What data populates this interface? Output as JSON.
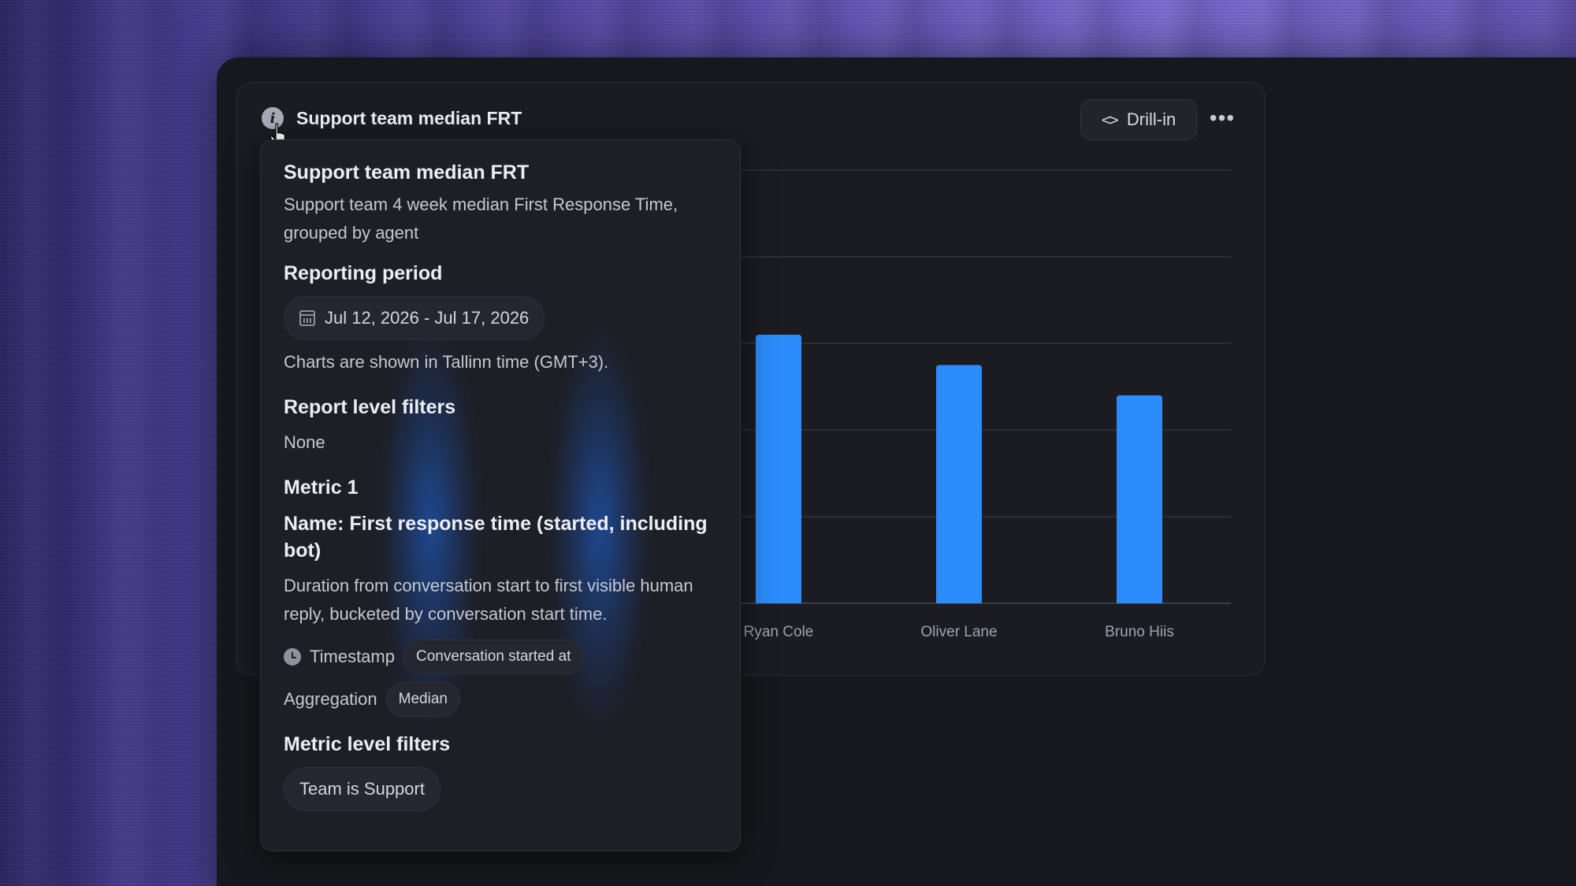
{
  "card": {
    "title": "Support team median FRT",
    "drill_label": "Drill-in",
    "info_icon": "info-icon",
    "more_icon": "more-horizontal-icon"
  },
  "chart_data": {
    "type": "bar",
    "categories": [
      "Ryan Cole",
      "Oliver Lane",
      "Bruno Hiis"
    ],
    "values": [
      3.1,
      2.75,
      2.4
    ],
    "ylim": [
      0,
      5
    ],
    "grid": true,
    "bar_color": "#2c8bfa"
  },
  "popover": {
    "title": "Support team median FRT",
    "description": "Support team 4 week median First Response Time, grouped by agent",
    "reporting_period_heading": "Reporting period",
    "date_range": "Jul 12, 2026 - Jul 17, 2026",
    "timezone_note": "Charts are shown in Tallinn time (GMT+3).",
    "report_filters_heading": "Report level filters",
    "report_filters_value": "None",
    "metric_heading": "Metric 1",
    "metric_name": "Name: First response time (started, including bot)",
    "metric_description": "Duration from conversation start to first visible human reply, bucketed by conversation start time.",
    "timestamp_label": "Timestamp",
    "timestamp_value": "Conversation started at",
    "aggregation_label": "Aggregation",
    "aggregation_value": "Median",
    "metric_filters_heading": "Metric level filters",
    "metric_filter_chip": "Team is Support"
  },
  "colors": {
    "accent": "#2c8bfa",
    "surface": "#1e1f26",
    "card": "#1b1c22"
  }
}
